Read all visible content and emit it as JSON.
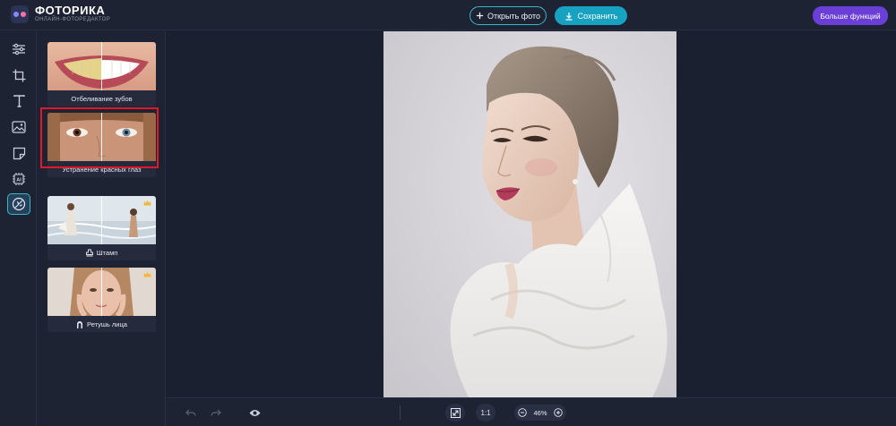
{
  "header": {
    "brand": "ФОТОРИКА",
    "brand_sub": "ОНЛАЙН-ФОТОРЕДАКТОР",
    "open_label": "Открыть фото",
    "save_label": "Сохранить",
    "more_label": "Больше функций"
  },
  "toolbar": {
    "tools": [
      {
        "icon": "sliders-icon"
      },
      {
        "icon": "crop-icon"
      },
      {
        "icon": "text-icon"
      },
      {
        "icon": "image-icon"
      },
      {
        "icon": "sticker-icon"
      },
      {
        "icon": "ai-chip-icon"
      },
      {
        "icon": "retouch-icon",
        "active": true
      }
    ]
  },
  "panel": {
    "cards": [
      {
        "label": "Отбеливание зубов",
        "premium": false
      },
      {
        "label": "Устранение красных глаз",
        "premium": false,
        "selected": true
      },
      {
        "label": "Штамп",
        "premium": true
      },
      {
        "label": "Ретушь лица",
        "premium": true
      }
    ]
  },
  "bottombar": {
    "ratio_label": "1:1",
    "zoom_label": "46%"
  },
  "colors": {
    "accent_cyan": "#17a2c2",
    "accent_purple": "#6a3fd7",
    "highlight_red": "#e0182a",
    "background": "#1b2030"
  }
}
